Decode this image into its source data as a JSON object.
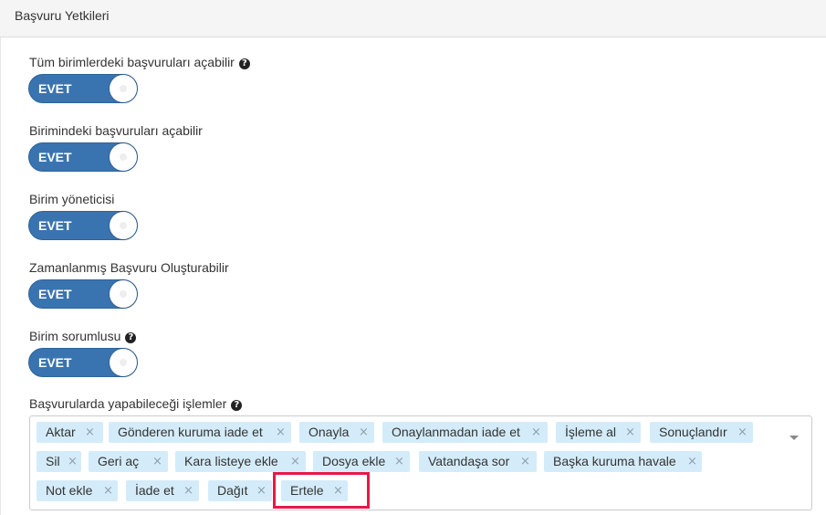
{
  "panel": {
    "title": "Başvuru Yetkileri"
  },
  "fields": {
    "f1": {
      "label": "Tüm birimlerdeki başvuruları açabilir",
      "toggle": "EVET"
    },
    "f2": {
      "label": "Birimindeki başvuruları açabilir",
      "toggle": "EVET"
    },
    "f3": {
      "label": "Birim yöneticisi",
      "toggle": "EVET"
    },
    "f4": {
      "label": "Zamanlanmış Başvuru Oluşturabilir",
      "toggle": "EVET"
    },
    "f5": {
      "label": "Birim sorumlusu",
      "toggle": "EVET"
    }
  },
  "help_icon": "?",
  "operations": {
    "label": "Başvurularda yapabileceği işlemler",
    "remove_symbol": "×",
    "tags": [
      "Aktar",
      "Gönderen kuruma iade et",
      "Onayla",
      "Onaylanmadan iade et",
      "İşleme al",
      "Sonuçlandır",
      "Sil",
      "Geri aç",
      "Kara listeye ekle",
      "Dosya ekle",
      "Vatandaşa sor",
      "Başka kuruma havale",
      "Not ekle",
      "İade et",
      "Dağıt",
      "Ertele"
    ]
  },
  "colors": {
    "toggle_on": "#3a74b0",
    "tag_bg": "#d4ecf9",
    "highlight": "#e8174a"
  }
}
